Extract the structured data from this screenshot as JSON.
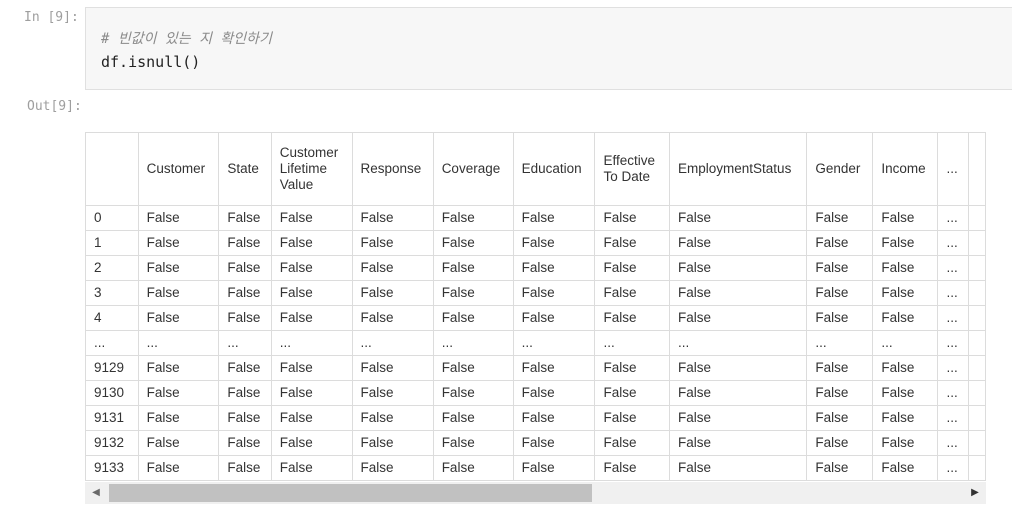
{
  "input_prompt": "In [9]:",
  "output_prompt": "Out[9]:",
  "code": {
    "comment": "# 빈값이 있는 지 확인하기",
    "line": "df.isnull()"
  },
  "table": {
    "columns": [
      "",
      "Customer",
      "State",
      "Customer Lifetime Value",
      "Response",
      "Coverage",
      "Education",
      "Effective To Date",
      "EmploymentStatus",
      "Gender",
      "Income",
      "..."
    ],
    "rows": [
      [
        "0",
        "False",
        "False",
        "False",
        "False",
        "False",
        "False",
        "False",
        "False",
        "False",
        "False",
        "..."
      ],
      [
        "1",
        "False",
        "False",
        "False",
        "False",
        "False",
        "False",
        "False",
        "False",
        "False",
        "False",
        "..."
      ],
      [
        "2",
        "False",
        "False",
        "False",
        "False",
        "False",
        "False",
        "False",
        "False",
        "False",
        "False",
        "..."
      ],
      [
        "3",
        "False",
        "False",
        "False",
        "False",
        "False",
        "False",
        "False",
        "False",
        "False",
        "False",
        "..."
      ],
      [
        "4",
        "False",
        "False",
        "False",
        "False",
        "False",
        "False",
        "False",
        "False",
        "False",
        "False",
        "..."
      ],
      [
        "...",
        "...",
        "...",
        "...",
        "...",
        "...",
        "...",
        "...",
        "...",
        "...",
        "...",
        "..."
      ],
      [
        "9129",
        "False",
        "False",
        "False",
        "False",
        "False",
        "False",
        "False",
        "False",
        "False",
        "False",
        "..."
      ],
      [
        "9130",
        "False",
        "False",
        "False",
        "False",
        "False",
        "False",
        "False",
        "False",
        "False",
        "False",
        "..."
      ],
      [
        "9131",
        "False",
        "False",
        "False",
        "False",
        "False",
        "False",
        "False",
        "False",
        "False",
        "False",
        "..."
      ],
      [
        "9132",
        "False",
        "False",
        "False",
        "False",
        "False",
        "False",
        "False",
        "False",
        "False",
        "False",
        "..."
      ],
      [
        "9133",
        "False",
        "False",
        "False",
        "False",
        "False",
        "False",
        "False",
        "False",
        "False",
        "False",
        "..."
      ]
    ]
  },
  "scrollbar": {
    "left_arrow": "◀",
    "right_arrow": "▶"
  }
}
